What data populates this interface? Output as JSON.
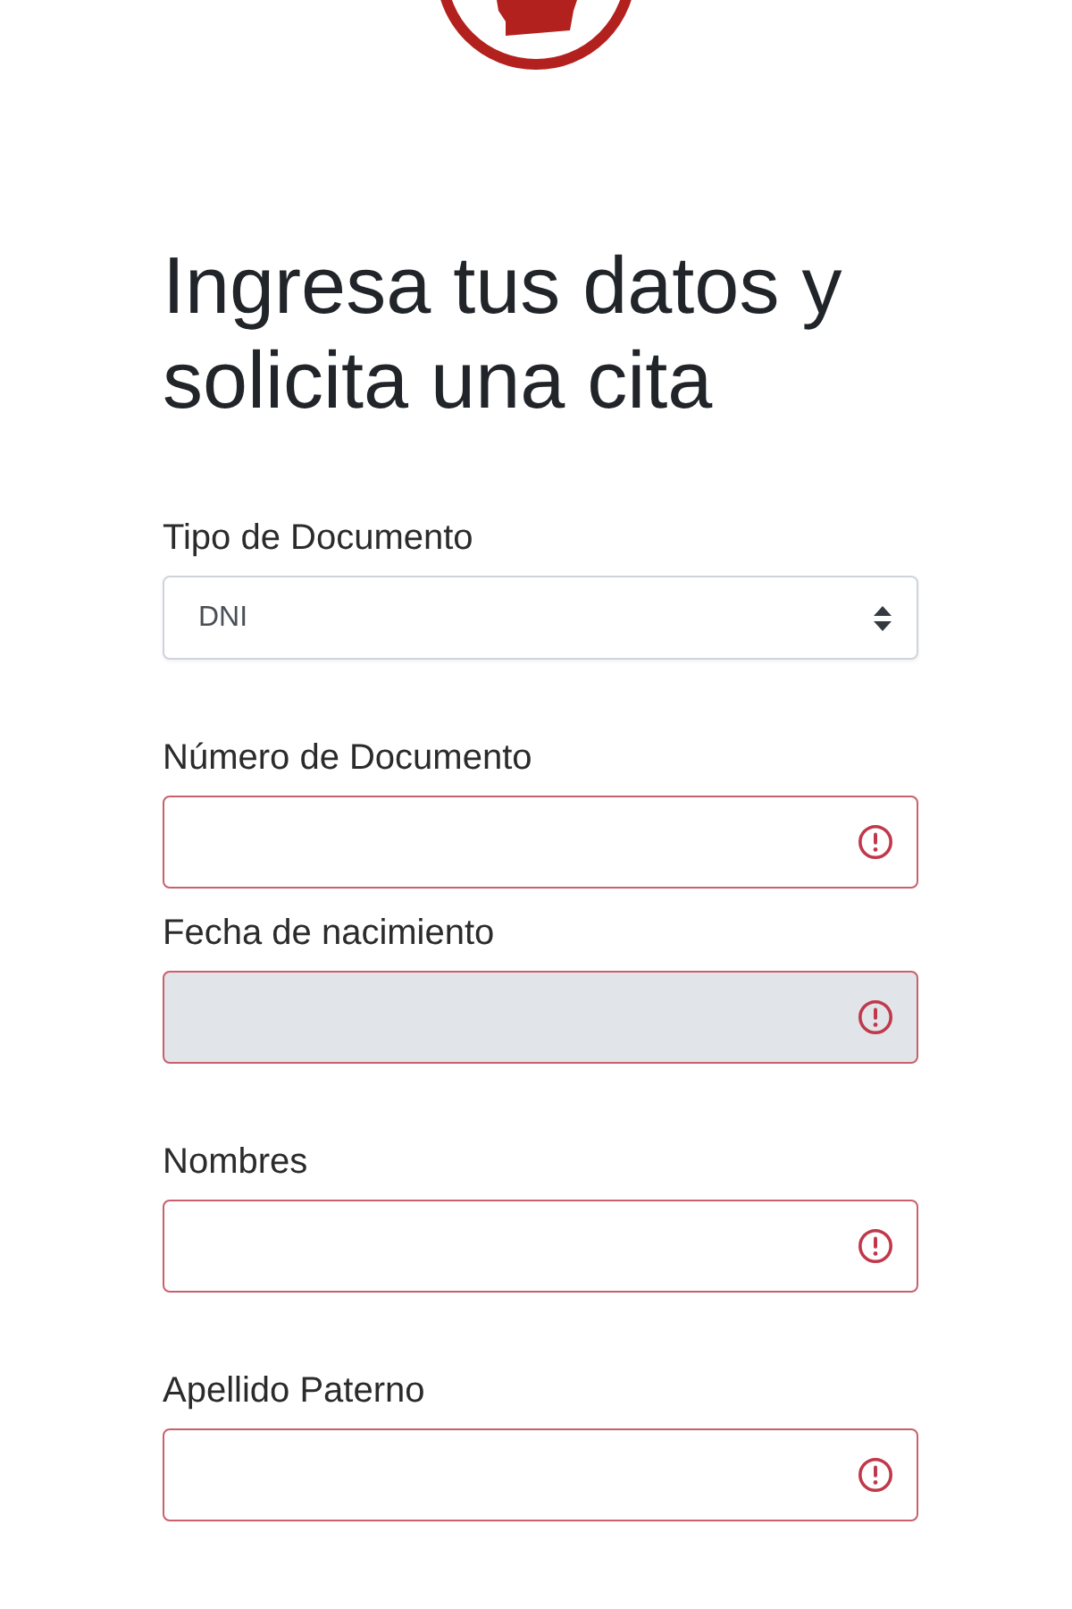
{
  "heading": "Ingresa tus datos y solicita una cita",
  "fields": [
    {
      "kind": "select",
      "label": "Tipo de Documento",
      "value": "DNI",
      "invalid": false,
      "disabled": false
    },
    {
      "kind": "text",
      "label": "Número de Documento",
      "invalid": true,
      "disabled": false
    },
    {
      "kind": "text",
      "label": "Fecha de nacimiento",
      "invalid": true,
      "disabled": true
    },
    {
      "kind": "text",
      "label": "Nombres",
      "invalid": true,
      "disabled": false
    },
    {
      "kind": "text",
      "label": "Apellido Paterno",
      "invalid": true,
      "disabled": false
    }
  ]
}
